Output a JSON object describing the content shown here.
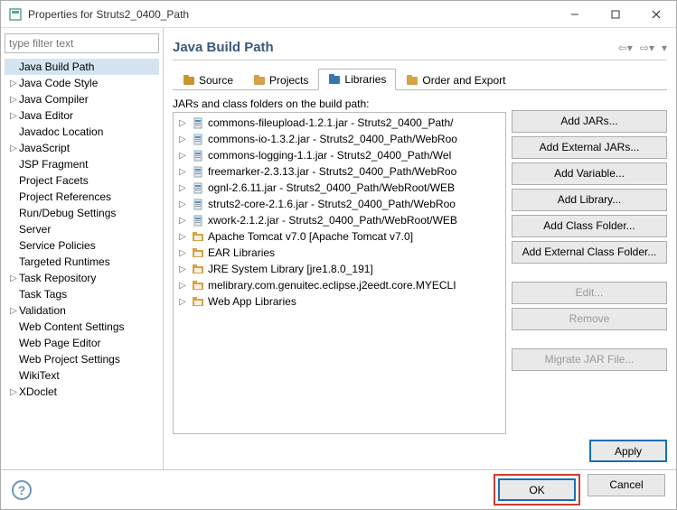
{
  "title": "Properties for Struts2_0400_Path",
  "filter_placeholder": "type filter text",
  "tree": [
    {
      "label": "Java Build Path",
      "exp": false,
      "lvl": 0,
      "sel": true
    },
    {
      "label": "Java Code Style",
      "exp": true,
      "lvl": 0
    },
    {
      "label": "Java Compiler",
      "exp": true,
      "lvl": 0
    },
    {
      "label": "Java Editor",
      "exp": true,
      "lvl": 0
    },
    {
      "label": "Javadoc Location",
      "exp": false,
      "lvl": 0
    },
    {
      "label": "JavaScript",
      "exp": true,
      "lvl": 0
    },
    {
      "label": "JSP Fragment",
      "exp": false,
      "lvl": 0
    },
    {
      "label": "Project Facets",
      "exp": false,
      "lvl": 0
    },
    {
      "label": "Project References",
      "exp": false,
      "lvl": 0
    },
    {
      "label": "Run/Debug Settings",
      "exp": false,
      "lvl": 0
    },
    {
      "label": "Server",
      "exp": false,
      "lvl": 0
    },
    {
      "label": "Service Policies",
      "exp": false,
      "lvl": 0
    },
    {
      "label": "Targeted Runtimes",
      "exp": false,
      "lvl": 0
    },
    {
      "label": "Task Repository",
      "exp": true,
      "lvl": 0
    },
    {
      "label": "Task Tags",
      "exp": false,
      "lvl": 0
    },
    {
      "label": "Validation",
      "exp": true,
      "lvl": 0
    },
    {
      "label": "Web Content Settings",
      "exp": false,
      "lvl": 0
    },
    {
      "label": "Web Page Editor",
      "exp": false,
      "lvl": 0
    },
    {
      "label": "Web Project Settings",
      "exp": false,
      "lvl": 0
    },
    {
      "label": "WikiText",
      "exp": false,
      "lvl": 0
    },
    {
      "label": "XDoclet",
      "exp": true,
      "lvl": 0
    }
  ],
  "header": "Java Build Path",
  "tabs": [
    {
      "label": "Source",
      "key": "source"
    },
    {
      "label": "Projects",
      "key": "projects"
    },
    {
      "label": "Libraries",
      "key": "libraries",
      "active": true
    },
    {
      "label": "Order and Export",
      "key": "order"
    }
  ],
  "list_label": "JARs and class folders on the build path:",
  "libs": [
    {
      "icon": "jar",
      "label": "commons-fileupload-1.2.1.jar - Struts2_0400_Path/"
    },
    {
      "icon": "jar",
      "label": "commons-io-1.3.2.jar - Struts2_0400_Path/WebRoo"
    },
    {
      "icon": "jar",
      "label": "commons-logging-1.1.jar - Struts2_0400_Path/Wel"
    },
    {
      "icon": "jar",
      "label": "freemarker-2.3.13.jar - Struts2_0400_Path/WebRoo"
    },
    {
      "icon": "jar",
      "label": "ognl-2.6.11.jar - Struts2_0400_Path/WebRoot/WEB"
    },
    {
      "icon": "jar",
      "label": "struts2-core-2.1.6.jar - Struts2_0400_Path/WebRoo"
    },
    {
      "icon": "jar",
      "label": "xwork-2.1.2.jar - Struts2_0400_Path/WebRoot/WEB"
    },
    {
      "icon": "fld",
      "label": "Apache Tomcat v7.0 [Apache Tomcat v7.0]"
    },
    {
      "icon": "fld",
      "label": "EAR Libraries"
    },
    {
      "icon": "fld",
      "label": "JRE System Library [jre1.8.0_191]"
    },
    {
      "icon": "fld",
      "label": "melibrary.com.genuitec.eclipse.j2eedt.core.MYECLI"
    },
    {
      "icon": "fld",
      "label": "Web App Libraries"
    }
  ],
  "side_btns": {
    "add_jars": "Add JARs...",
    "add_ext_jars": "Add External JARs...",
    "add_var": "Add Variable...",
    "add_lib": "Add Library...",
    "add_cls": "Add Class Folder...",
    "add_ext_cls": "Add External Class Folder...",
    "edit": "Edit...",
    "remove": "Remove",
    "migrate": "Migrate JAR File..."
  },
  "apply": "Apply",
  "ok": "OK",
  "cancel": "Cancel"
}
